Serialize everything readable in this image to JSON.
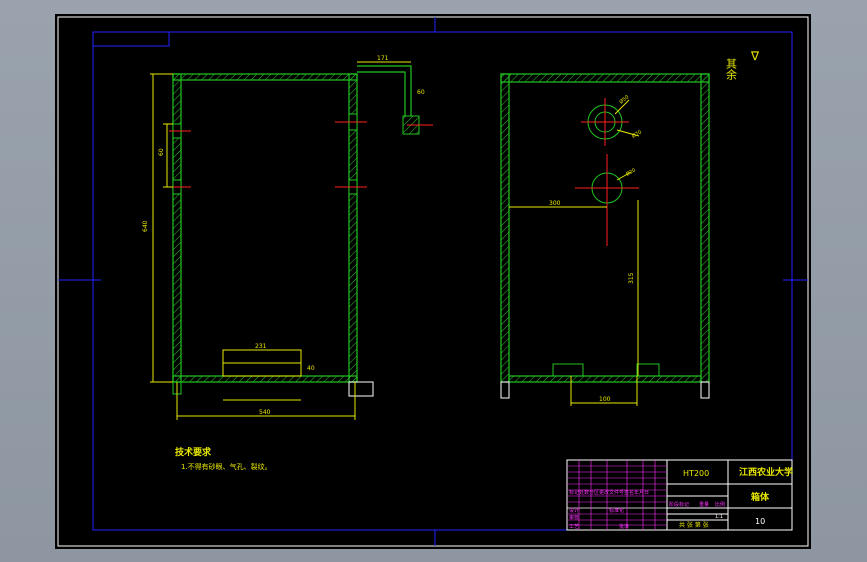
{
  "colors": {
    "background": "#000000",
    "frame": "#ffffff",
    "border": "#2222ff",
    "wall": "#22c522",
    "dimension": "#e8e800",
    "center": "#ff2020",
    "text_yellow": "#e8e800",
    "text_magenta": "#ff33ff",
    "text_white": "#ffffff"
  },
  "roughness": {
    "label": "其余",
    "symbol": "∇"
  },
  "dimensions": {
    "top_pipe": "171",
    "side_short": "60",
    "height_mark": "60",
    "total_height": "640",
    "bottom_width": "540",
    "window_width": "231",
    "window_height": "40",
    "right_horizontal": "300",
    "right_vertical": "315",
    "right_bottom": "100",
    "circle_a": "Ø50",
    "circle_b": "Ø70",
    "circle_c": "Ø20"
  },
  "tech": {
    "heading": "技术要求",
    "line1": "1.不得有砂眼、气孔、裂纹。"
  },
  "title_block": {
    "material": "HT200",
    "school": "江西农业大学",
    "part_name": "箱体",
    "scale": "10",
    "scale_label": "1:1",
    "stage_label": "阶段标记",
    "weight_label": "重量",
    "ratio_label": "比例",
    "sheet_label": "共 张 第 张",
    "design_label": "设计",
    "check_label": "审核",
    "process_label": "工艺",
    "standard_label": "标准化",
    "approve_label": "批准",
    "rev_header": "标记处数分区更改文件号签名年月日"
  }
}
